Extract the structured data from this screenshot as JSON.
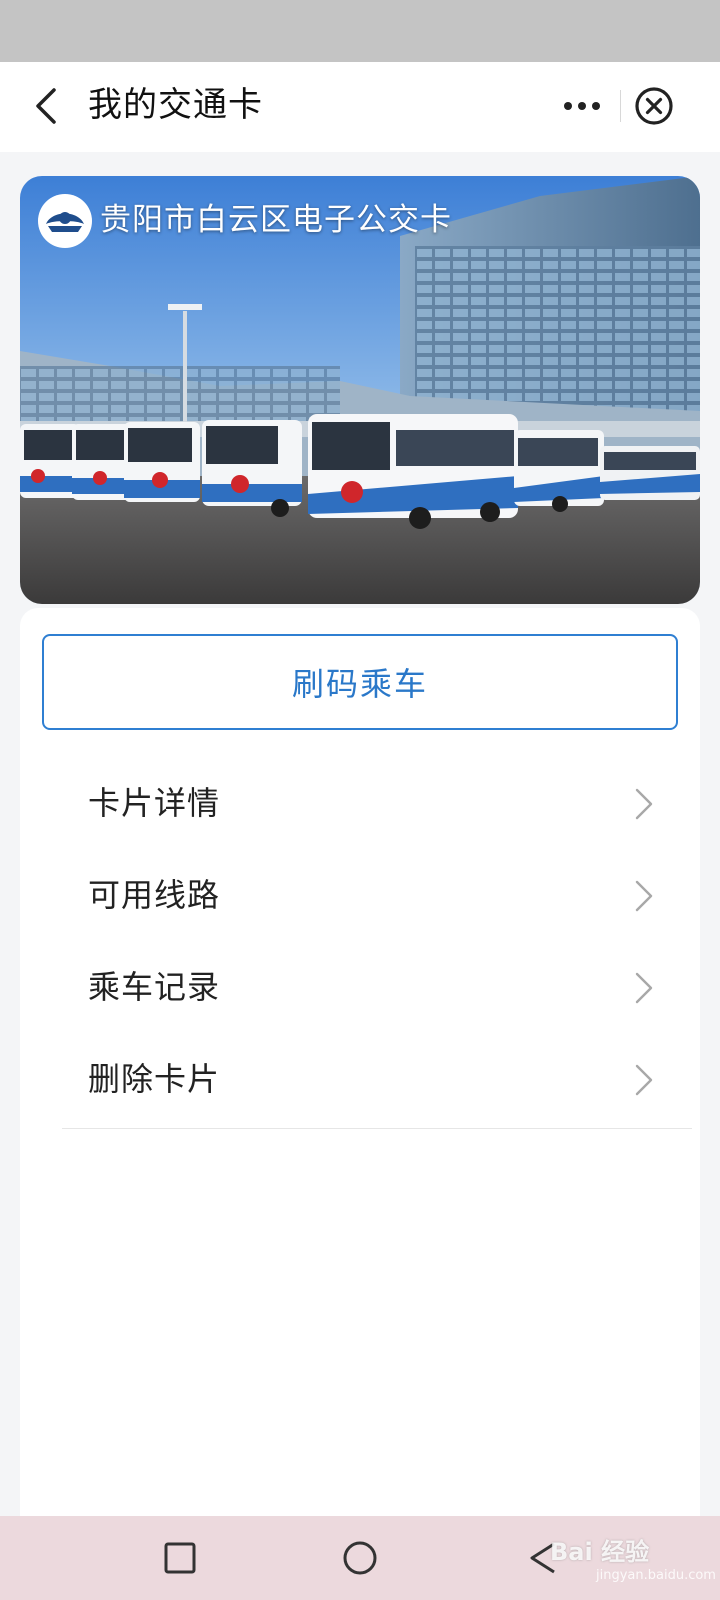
{
  "header": {
    "title": "我的交通卡"
  },
  "card": {
    "title": "贵阳市白云区电子公交卡"
  },
  "main": {
    "ride_button_label": "刷码乘车",
    "menu": [
      {
        "label": "卡片详情"
      },
      {
        "label": "可用线路"
      },
      {
        "label": "乘车记录"
      },
      {
        "label": "删除卡片"
      }
    ]
  },
  "watermark": {
    "text": "Bai 经验",
    "sub": "jingyan.baidu.com"
  },
  "colors": {
    "accent": "#2a78c9",
    "nav_background": "#ffffff",
    "system_nav_background": "#ecd9dd"
  }
}
